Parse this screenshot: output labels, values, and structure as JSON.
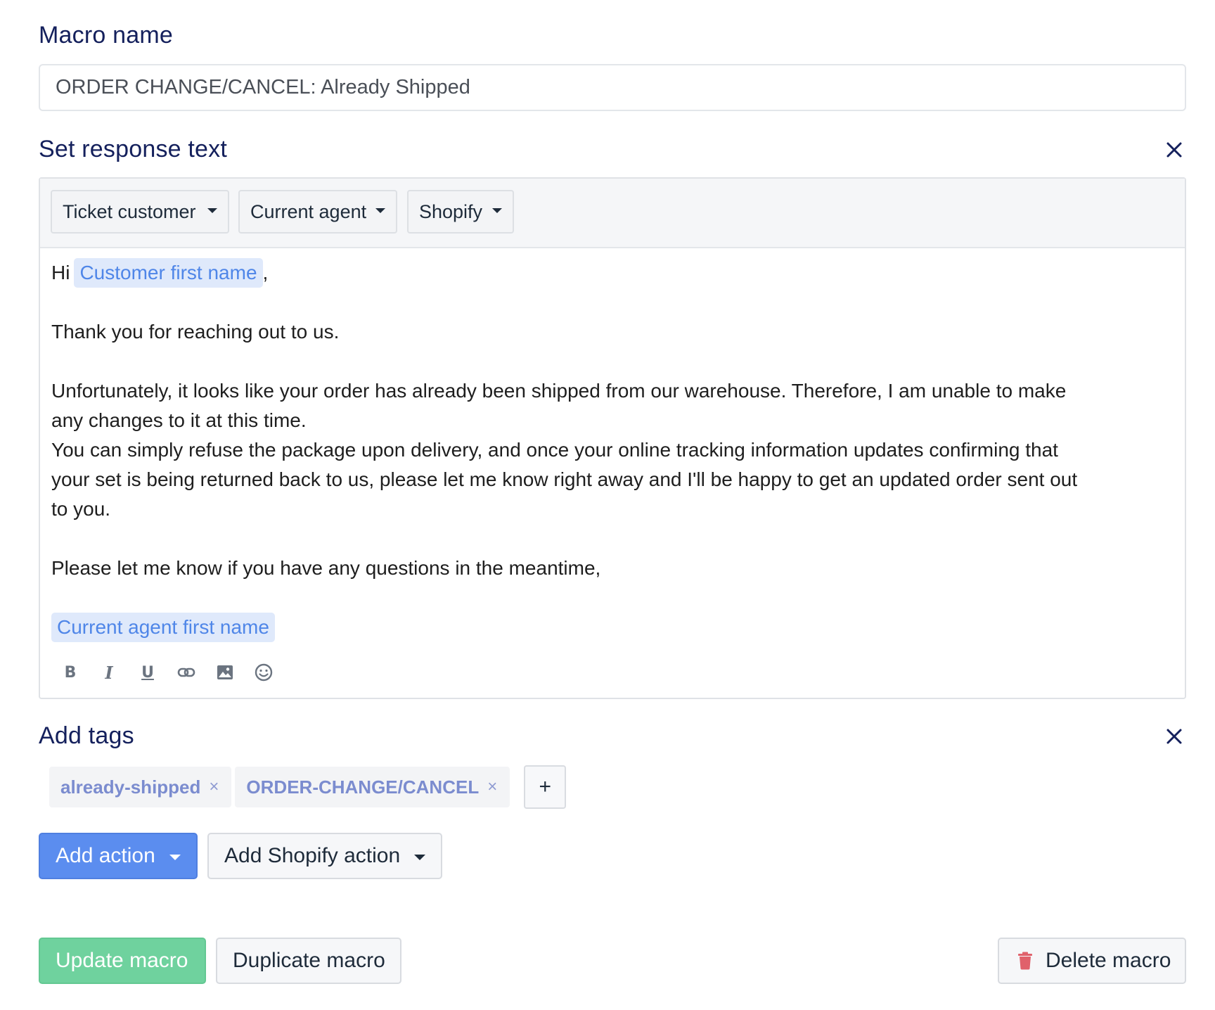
{
  "macro_name": {
    "label": "Macro name",
    "value": "ORDER CHANGE/CANCEL: Already Shipped"
  },
  "response": {
    "title": "Set response text",
    "close_icon": "close-icon",
    "variable_dropdowns": [
      "Ticket customer",
      "Current agent",
      "Shopify"
    ],
    "body": {
      "greeting_prefix": "Hi",
      "customer_variable": "Customer first name",
      "greeting_suffix": ",",
      "line_thanks": "Thank you for reaching out to us.",
      "line_unfortunately_1": "Unfortunately, it looks like your order has already been shipped from our warehouse. Therefore, I am unable to make",
      "line_unfortunately_2": "any changes to it at this time.",
      "line_refuse_1": "You can simply refuse the package upon delivery, and once your online tracking information updates confirming that",
      "line_refuse_2": "your set is being returned back to us, please let me know right away and I'll be happy to get an updated order sent out",
      "line_refuse_3": "to you.",
      "line_questions": "Please let me know if you have any questions in the meantime,",
      "agent_variable": "Current agent first name"
    },
    "format_toolbar": {
      "bold": "B",
      "italic": "I",
      "underline": "U",
      "icons": [
        "link-icon",
        "image-icon",
        "emoji-icon"
      ]
    }
  },
  "tags": {
    "title": "Add tags",
    "items": [
      "already-shipped",
      "ORDER-CHANGE/CANCEL"
    ],
    "remove_glyph": "×",
    "add_glyph": "+"
  },
  "actions": {
    "add_action": "Add action",
    "add_shopify_action": "Add Shopify action"
  },
  "footer": {
    "update": "Update macro",
    "duplicate": "Duplicate macro",
    "delete": "Delete macro"
  },
  "colors": {
    "heading": "#14205c",
    "primary": "#5b8def",
    "success": "#6fd29e",
    "danger_icon": "#e0616b",
    "variable_chip_bg": "#dfe9fb",
    "variable_chip_text": "#4f86e8",
    "tag_text": "#7b8ccf"
  }
}
